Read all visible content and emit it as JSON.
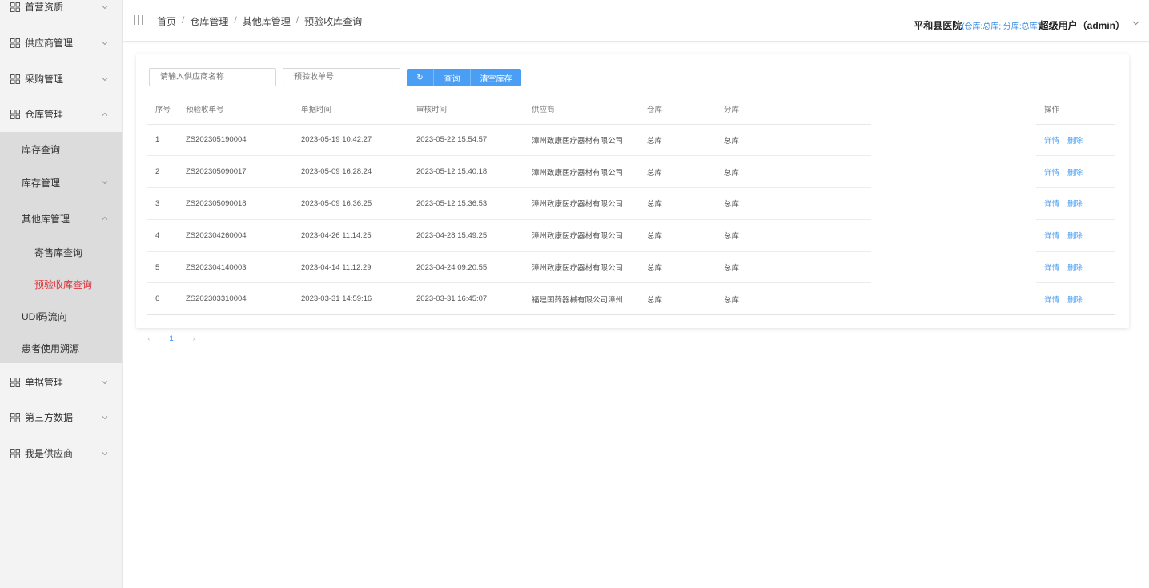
{
  "sidebar": {
    "top_items": [
      {
        "label": "首营资质"
      },
      {
        "label": "供应商管理"
      },
      {
        "label": "采购管理"
      },
      {
        "label": "仓库管理"
      }
    ],
    "warehouse_sub": {
      "stock_query": "库存查询",
      "stock_manage": "库存管理",
      "other_manage": "其他库管理",
      "consign_query": "寄售库查询",
      "precheck_query": "预验收库查询",
      "udi_flow": "UDI码流向",
      "patient_trace": "患者使用溯源"
    },
    "bottom_items": [
      {
        "label": "单据管理"
      },
      {
        "label": "第三方数据"
      },
      {
        "label": "我是供应商"
      }
    ]
  },
  "header": {
    "breadcrumb": [
      "首页",
      "仓库管理",
      "其他库管理",
      "预验收库查询"
    ],
    "separator": "/",
    "hospital": "平和县医院",
    "scope": "(仓库:总库; 分库:总库)",
    "user": "超级用户（admin）"
  },
  "filters": {
    "supplier_placeholder": "请输入供应商名称",
    "order_placeholder": "预验收单号",
    "refresh_icon": "↻",
    "query_label": "查询",
    "clear_label": "清空库存"
  },
  "table": {
    "columns": [
      "序号",
      "预验收单号",
      "单据时间",
      "审核时间",
      "供应商",
      "仓库",
      "分库",
      "操作"
    ],
    "rows": [
      {
        "no": "1",
        "order": "ZS202305190004",
        "doc_time": "2023-05-19 10:42:27",
        "audit_time": "2023-05-22 15:54:57",
        "supplier": "漳州致康医疗器材有限公司",
        "warehouse": "总库",
        "sub": "总库"
      },
      {
        "no": "2",
        "order": "ZS202305090017",
        "doc_time": "2023-05-09 16:28:24",
        "audit_time": "2023-05-12 15:40:18",
        "supplier": "漳州致康医疗器材有限公司",
        "warehouse": "总库",
        "sub": "总库"
      },
      {
        "no": "3",
        "order": "ZS202305090018",
        "doc_time": "2023-05-09 16:36:25",
        "audit_time": "2023-05-12 15:36:53",
        "supplier": "漳州致康医疗器材有限公司",
        "warehouse": "总库",
        "sub": "总库"
      },
      {
        "no": "4",
        "order": "ZS202304260004",
        "doc_time": "2023-04-26 11:14:25",
        "audit_time": "2023-04-28 15:49:25",
        "supplier": "漳州致康医疗器材有限公司",
        "warehouse": "总库",
        "sub": "总库"
      },
      {
        "no": "5",
        "order": "ZS202304140003",
        "doc_time": "2023-04-14 11:12:29",
        "audit_time": "2023-04-24 09:20:55",
        "supplier": "漳州致康医疗器材有限公司",
        "warehouse": "总库",
        "sub": "总库"
      },
      {
        "no": "6",
        "order": "ZS202303310004",
        "doc_time": "2023-03-31 14:59:16",
        "audit_time": "2023-03-31 16:45:07",
        "supplier": "福建国药器械有限公司漳州…",
        "warehouse": "总库",
        "sub": "总库"
      }
    ],
    "detail_label": "详情",
    "delete_label": "删除"
  },
  "pagination": {
    "prev": "‹",
    "current": "1",
    "next": "›"
  },
  "colors": {
    "accent": "#4a9ff5",
    "active_menu": "#d9363e",
    "scope_text": "#3b8de0"
  }
}
